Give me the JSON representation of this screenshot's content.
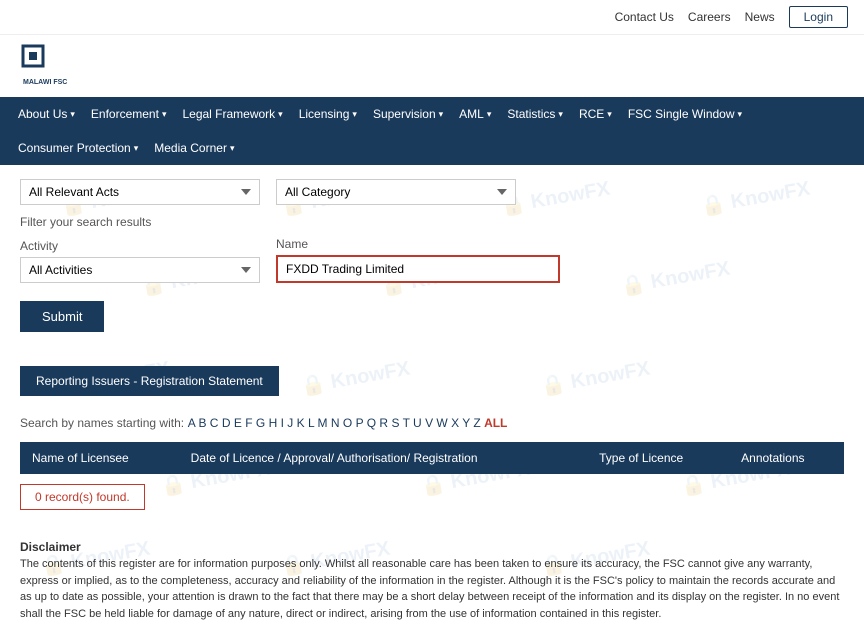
{
  "topbar": {
    "contact_label": "Contact Us",
    "careers_label": "Careers",
    "news_label": "News",
    "login_label": "Login"
  },
  "nav": {
    "items": [
      {
        "label": "About Us",
        "has_arrow": true
      },
      {
        "label": "Enforcement",
        "has_arrow": true
      },
      {
        "label": "Legal Framework",
        "has_arrow": true
      },
      {
        "label": "Licensing",
        "has_arrow": true
      },
      {
        "label": "Supervision",
        "has_arrow": true
      },
      {
        "label": "AML",
        "has_arrow": true
      },
      {
        "label": "Statistics",
        "has_arrow": true
      },
      {
        "label": "RCE",
        "has_arrow": true
      },
      {
        "label": "FSC Single Window",
        "has_arrow": true
      },
      {
        "label": "Consumer Protection",
        "has_arrow": true
      },
      {
        "label": "Media Corner",
        "has_arrow": true
      }
    ]
  },
  "filters": {
    "acts_label": "All Relevant Acts",
    "category_label": "All Category",
    "filter_title": "Filter your search results",
    "activity_label": "Activity",
    "activity_value": "All Activities",
    "name_label": "Name",
    "name_value": "FXDD Trading Limited",
    "submit_label": "Submit"
  },
  "reporting_btn": {
    "label": "Reporting Issuers - Registration Statement"
  },
  "alpha_search": {
    "prefix": "Search by names starting with:",
    "letters": [
      "A",
      "B",
      "C",
      "D",
      "E",
      "F",
      "G",
      "H",
      "I",
      "J",
      "K",
      "L",
      "M",
      "N",
      "O",
      "P",
      "Q",
      "R",
      "S",
      "T",
      "U",
      "V",
      "W",
      "X",
      "Y",
      "Z"
    ],
    "all_label": "ALL"
  },
  "table": {
    "columns": [
      "Name of Licensee",
      "Date of Licence / Approval/ Authorisation/ Registration",
      "Type of Licence",
      "Annotations"
    ]
  },
  "results": {
    "no_records_msg": "0 record(s) found."
  },
  "disclaimer": {
    "title": "Disclaimer",
    "text": "The contents of this register are for information purposes only. Whilst all reasonable care has been taken to ensure its accuracy, the FSC cannot give any warranty, express or implied, as to the completeness, accuracy and reliability of the information in the register. Although it is the FSC's policy to maintain the records accurate and as up to date as possible, your attention is drawn to the fact that there may be a short delay between receipt of the information and its display on the register. In no event shall the FSC be held liable for damage of any nature, direct or indirect, arising from the use of information contained in this register."
  },
  "watermark": {
    "text": "KnowFX"
  }
}
